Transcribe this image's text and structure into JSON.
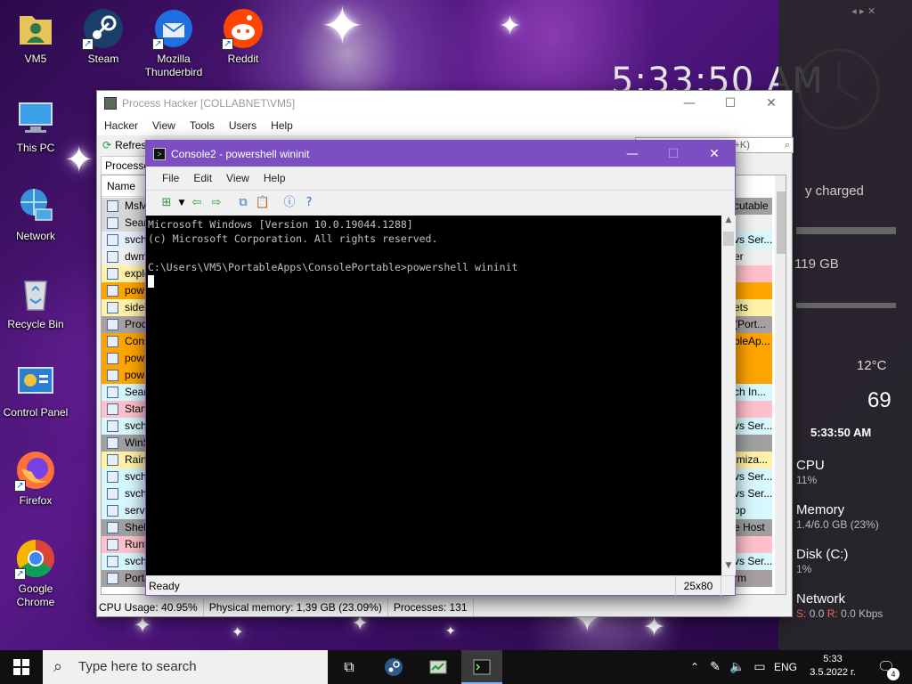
{
  "desktop": {
    "icons": [
      {
        "label": "VM5"
      },
      {
        "label": "Steam"
      },
      {
        "label": "Mozilla Thunderbird"
      },
      {
        "label": "Reddit"
      },
      {
        "label": "This PC"
      },
      {
        "label": "Network"
      },
      {
        "label": "Recycle Bin"
      },
      {
        "label": "Control Panel"
      },
      {
        "label": "Firefox"
      },
      {
        "label": "Google Chrome"
      }
    ]
  },
  "big_clock": "5:33:50 AM",
  "widgets": {
    "battery": "y charged",
    "disk_free": "119 GB",
    "temp": "12°C",
    "humidity": "69",
    "clock_small": "5:33:50 AM",
    "cpu_label": "CPU",
    "cpu_value": "11%",
    "mem_label": "Memory",
    "mem_value": "1.4/6.0 GB (23%)",
    "disk_label": "Disk (C:)",
    "disk_value": "1%",
    "net_label": "Network",
    "net_s_label": "S:",
    "net_s_value": "0.0",
    "net_r_label": "R:",
    "net_r_value": "0.0 Kbps"
  },
  "process_hacker": {
    "title": "Process Hacker [COLLABNET\\VM5]",
    "menu": [
      "Hacker",
      "View",
      "Tools",
      "Users",
      "Help"
    ],
    "refresh": "Refres",
    "tab": "Processes",
    "column_name": "Name",
    "search_hint": "l+K)",
    "rows": [
      {
        "name": "MsM",
        "color": "#d8d8d8"
      },
      {
        "name": "Sear",
        "color": "#d8d8d8"
      },
      {
        "name": "svch",
        "color": "#e6f0ff"
      },
      {
        "name": "dwm",
        "color": "#f0f0f0"
      },
      {
        "name": "explo",
        "color": "#fff2a8"
      },
      {
        "name": "pow",
        "color": "#ffa500"
      },
      {
        "name": "sideb",
        "color": "#fff2a8"
      },
      {
        "name": "Proce",
        "color": "#a8a0a0"
      },
      {
        "name": "Cons",
        "color": "#ffa500"
      },
      {
        "name": "pow",
        "color": "#ffa500"
      },
      {
        "name": "pow",
        "color": "#ffa500"
      },
      {
        "name": "Searc",
        "color": "#d8f8ff"
      },
      {
        "name": "Start",
        "color": "#ffc0cb"
      },
      {
        "name": "svch",
        "color": "#d8f8ff"
      },
      {
        "name": "WinS",
        "color": "#a0a0a0"
      },
      {
        "name": "Rain",
        "color": "#fff2a8"
      },
      {
        "name": "svch",
        "color": "#d8f8ff"
      },
      {
        "name": "svch",
        "color": "#d8f8ff"
      },
      {
        "name": "servi",
        "color": "#d8f8ff"
      },
      {
        "name": "Shell",
        "color": "#a0a0a0"
      },
      {
        "name": "Runt",
        "color": "#ffc0cb"
      },
      {
        "name": "svch",
        "color": "#d8f8ff"
      },
      {
        "name": "Porta",
        "color": "#a8a0a0"
      }
    ],
    "right_cells": [
      {
        "text": "cutable",
        "color": "#a0a0a0"
      },
      {
        "text": "",
        "color": "#f0f0f0"
      },
      {
        "text": "vs Ser...",
        "color": "#d8f8ff"
      },
      {
        "text": "er",
        "color": "#f0f0f0"
      },
      {
        "text": "",
        "color": "#ffc0cb"
      },
      {
        "text": "",
        "color": "#ffa500"
      },
      {
        "text": "ets",
        "color": "#fff2a8"
      },
      {
        "text": "(Port...",
        "color": "#a8a0a0"
      },
      {
        "text": "bleAp...",
        "color": "#ffa500"
      },
      {
        "text": "",
        "color": "#ffa500"
      },
      {
        "text": "",
        "color": "#ffa500"
      },
      {
        "text": "ch In...",
        "color": "#d8f8ff"
      },
      {
        "text": "",
        "color": "#ffc0cb"
      },
      {
        "text": "vs Ser...",
        "color": "#d8f8ff"
      },
      {
        "text": "",
        "color": "#a0a0a0"
      },
      {
        "text": "imiza...",
        "color": "#fff2a8"
      },
      {
        "text": "vs Ser...",
        "color": "#d8f8ff"
      },
      {
        "text": "vs Ser...",
        "color": "#d8f8ff"
      },
      {
        "text": "pp",
        "color": "#d8f8ff"
      },
      {
        "text": "e Host",
        "color": "#a0a0a0"
      },
      {
        "text": "",
        "color": "#ffc0cb"
      },
      {
        "text": "vs Ser...",
        "color": "#d8f8ff"
      },
      {
        "text": "rm",
        "color": "#a8a0a0"
      }
    ],
    "status": {
      "cpu": "CPU Usage: 40.95%",
      "memory": "Physical memory: 1,39 GB (23.09%)",
      "processes": "Processes: 131"
    }
  },
  "console": {
    "title": "Console2 - powershell  wininit",
    "menu": [
      "File",
      "Edit",
      "View",
      "Help"
    ],
    "lines": [
      "Microsoft Windows [Version 10.0.19044.1288]",
      "(c) Microsoft Corporation. All rights reserved.",
      "",
      "C:\\Users\\VM5\\PortableApps\\ConsolePortable>powershell wininit"
    ],
    "status": "Ready",
    "size": "25x80"
  },
  "taskbar": {
    "search_placeholder": "Type here to search",
    "lang": "ENG",
    "time": "5:33",
    "date": "3.5.2022 г.",
    "notifications": "4"
  }
}
